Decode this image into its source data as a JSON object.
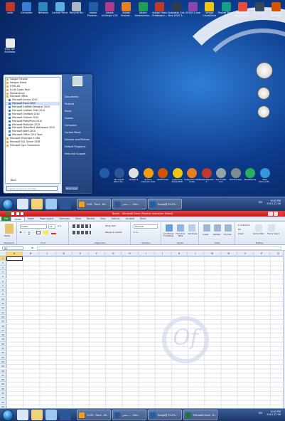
{
  "desktop": {
    "top_icons": [
      {
        "label": "solid",
        "color": "#c0392b"
      },
      {
        "label": "Computer",
        "color": "#3a7bd5"
      },
      {
        "label": "Network",
        "color": "#2e86c1"
      },
      {
        "label": "Control Panel",
        "color": "#5dade2"
      },
      {
        "label": "Recycle Bin",
        "color": "#aab7c4"
      },
      {
        "label": "Adobe Photosh...",
        "color": "#1e5fa8"
      },
      {
        "label": "Adobe InDesign CS5",
        "color": "#b03a8c"
      },
      {
        "label": "Adobe Illustrat...",
        "color": "#e67e22"
      },
      {
        "label": "Adobe Dreamweav...",
        "color": "#1f9e5a"
      },
      {
        "label": "Adobe Flash Profession...",
        "color": "#c0392b"
      },
      {
        "label": "Autodesk 3ds Max 2010 3...",
        "color": "#2c3e50"
      },
      {
        "label": "2010/11.exe",
        "color": "#8e44ad"
      },
      {
        "label": "Virtual CloneDrive",
        "color": "#f1c40f"
      },
      {
        "label": "Packet Tracer 5.3",
        "color": "#16a085"
      },
      {
        "label": "Ashampoo Music Studi...",
        "color": "#e74c3c"
      },
      {
        "label": "HTML Kit",
        "color": "#34495e"
      },
      {
        "label": "Free FTP Manager",
        "color": "#d35400"
      }
    ],
    "side_icons": [
      {
        "label": "Easy GIF Animator"
      }
    ],
    "start_menu": {
      "programs": [
        "Google Chrome",
        "Hotspot Shield",
        "HTML-Kit",
        "K-Lite Codec Pack",
        "Maintenance",
        "Microsoft Office",
        "Microsoft Access 2010",
        "Microsoft Excel 2010",
        "Microsoft InfoPath Designer 2010",
        "Microsoft InfoPath Filler 2010",
        "Microsoft OneNote 2010",
        "Microsoft Outlook 2010",
        "Microsoft PowerPoint 2010",
        "Microsoft Publisher 2010",
        "Microsoft SharePoint Workspace 2010",
        "Microsoft Word 2010",
        "Microsoft Office 2010 Tools",
        "Microsoft Silverlight 5 SDK",
        "Microsoft SQL Server 2008",
        "Microsoft Sync Framework"
      ],
      "selected_index": 7,
      "back_label": "Back",
      "search_placeholder": "Search programs and files",
      "right_items": [
        "Documents",
        "Pictures",
        "Music",
        "Games",
        "Computer",
        "Control Panel",
        "Devices and Printers",
        "Default Programs",
        "Help and Support"
      ],
      "shutdown_label": "Shut down"
    },
    "dock": [
      {
        "label": "",
        "color": "#1e5fa8"
      },
      {
        "label": "Microsoft Word 20...",
        "color": "#2b5797"
      },
      {
        "label": "SnagIt 9",
        "color": "#e0e0e0"
      },
      {
        "label": "Screen Capture Club",
        "color": "#f39c12"
      },
      {
        "label": "SWiSHmax",
        "color": "#d35400"
      },
      {
        "label": "Cyberlink PowerDVD",
        "color": "#f1c40f"
      },
      {
        "label": "Cyberlink DVD Suite",
        "color": "#e67e22"
      },
      {
        "label": "Adobe Reader X",
        "color": "#c0392b"
      },
      {
        "label": "Set Folder Icon",
        "color": "#95a5a6"
      },
      {
        "label": "Kill Process",
        "color": "#7f8c8d"
      },
      {
        "label": "BlueStacks",
        "color": "#27ae60"
      },
      {
        "label": "New Microsoft...",
        "color": "#3498db"
      }
    ],
    "taskbar": {
      "tasks": [
        {
          "label": "9.06 - Track - Wi...",
          "color": "#f39c12"
        },
        {
          "label": "منتدى ... - Micr...",
          "color": "#2b5797"
        },
        {
          "label": "Snagit@ 33.3%...",
          "color": "#1e5fa8"
        }
      ],
      "tray_lang": "EN",
      "time": "6:05 PM",
      "date": "2013-12-06"
    }
  },
  "excel": {
    "title": "Book1 - Microsoft Excel (Product Activation Failed)",
    "tabs": [
      "File",
      "Home",
      "Insert",
      "Page Layout",
      "Formulas",
      "Data",
      "Review",
      "View",
      "Add-Ins",
      "Acrobat",
      "Team"
    ],
    "active_tab": "Home",
    "ribbon": {
      "clipboard": {
        "label": "Clipboard",
        "paste": "Paste"
      },
      "font": {
        "label": "Font",
        "name": "Calibri",
        "size": "11"
      },
      "alignment": {
        "label": "Alignment",
        "wrap": "Wrap Text",
        "merge": "Merge & Center"
      },
      "number": {
        "label": "Number",
        "format": "General"
      },
      "styles": {
        "label": "Styles",
        "conditional": "Conditional Formatting",
        "format_table": "Format as Table",
        "cell_styles": "Cell Styles"
      },
      "cells": {
        "label": "Cells",
        "insert": "Insert",
        "delete": "Delete",
        "format": "Format"
      },
      "editing": {
        "label": "Editing",
        "autosum": "AutoSum",
        "fill": "Fill",
        "clear": "Clear",
        "sort": "Sort & Filter",
        "find": "Find & Select"
      }
    },
    "name_box": "A1",
    "fx": "fx",
    "columns": [
      "A",
      "B",
      "C",
      "D",
      "E",
      "F",
      "G",
      "H",
      "I",
      "J",
      "K",
      "L",
      "M",
      "N",
      "O",
      "P",
      "Q",
      "R"
    ],
    "rows": [
      "1",
      "2",
      "3",
      "4",
      "5",
      "6",
      "7",
      "8",
      "9",
      "10",
      "11",
      "12",
      "13",
      "14",
      "15",
      "16",
      "17",
      "18",
      "19",
      "20",
      "21",
      "22",
      "23",
      "24",
      "25",
      "26",
      "27",
      "28",
      "29",
      "30",
      "31",
      "32",
      "33",
      "34"
    ],
    "sheets": [
      "Sheet1",
      "Sheet2",
      "Sheet3"
    ],
    "active_sheet": "Sheet1",
    "status": "Ready",
    "zoom": "100%",
    "taskbar": {
      "tasks": [
        {
          "label": "11.05 - Track - Wi...",
          "color": "#f39c12"
        },
        {
          "label": "منتدى ... - Micr...",
          "color": "#2b5797"
        },
        {
          "label": "Snagit@ 33.3%...",
          "color": "#1e5fa8"
        },
        {
          "label": "Microsoft Excel - B...",
          "color": "#217346"
        }
      ],
      "tray_lang": "EN",
      "time": "6:05 PM",
      "date": "2013-12-06"
    }
  }
}
